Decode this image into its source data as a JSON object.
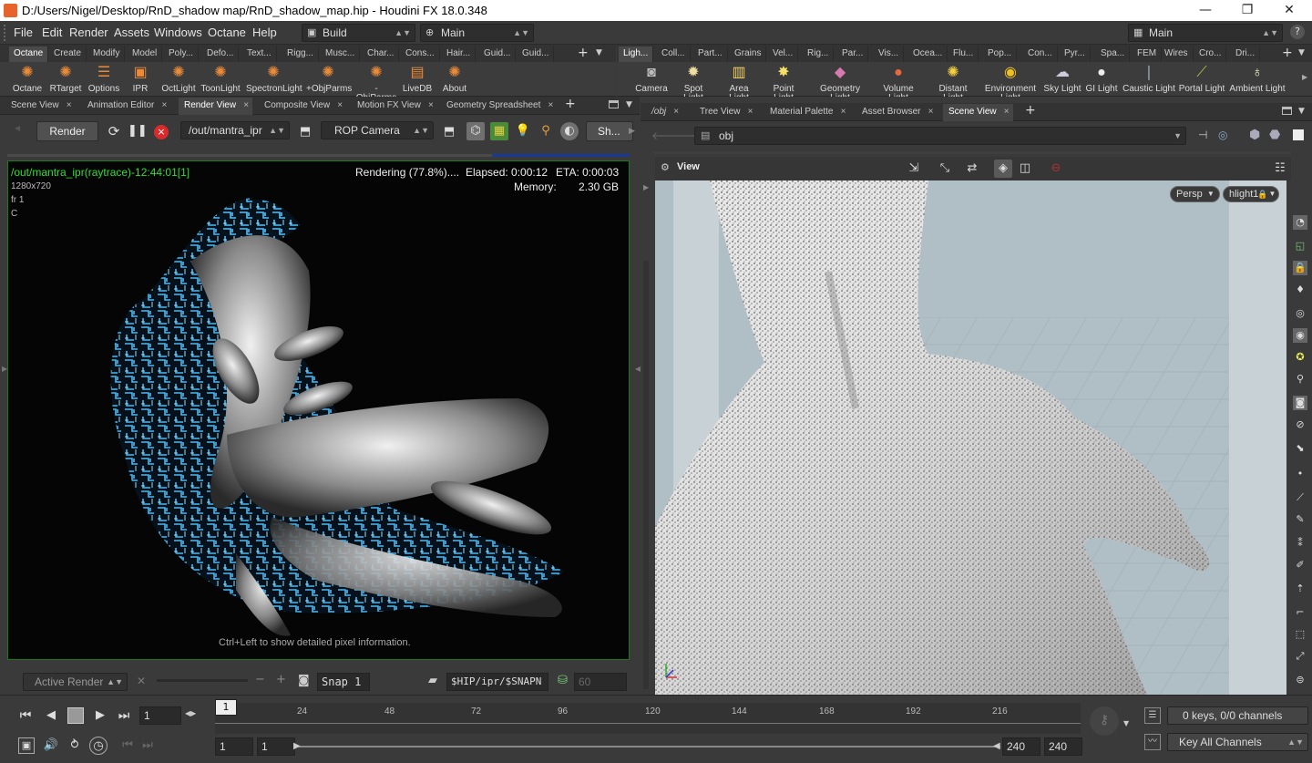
{
  "window": {
    "title": "D:/Users/Nigel/Desktop/RnD_shadow map/RnD_shadow_map.hip - Houdini FX 18.0.348",
    "controls": [
      "—",
      "❐",
      "✕"
    ]
  },
  "menubar": {
    "items": [
      "File",
      "Edit",
      "Render",
      "Assets",
      "Windows",
      "Octane",
      "Help"
    ],
    "desktop": "Build",
    "context": "Main",
    "right_desktop": "Main"
  },
  "shelf_left": {
    "tabs": [
      "Octane",
      "Create",
      "Modify",
      "Model",
      "Poly...",
      "Defo...",
      "Text...",
      "Rigg...",
      "Musc...",
      "Char...",
      "Cons...",
      "Hair...",
      "Guid...",
      "Guid..."
    ],
    "tools": [
      "Octane",
      "RTarget",
      "Options",
      "IPR",
      "OctLight",
      "ToonLight",
      "SpectronLight",
      "+ObjParms",
      "-ObjParms",
      "LiveDB",
      "About"
    ]
  },
  "shelf_right": {
    "tabs": [
      "Ligh...",
      "Coll...",
      "Part...",
      "Grains",
      "Vel...",
      "Rig...",
      "Par...",
      "Vis...",
      "Ocea...",
      "Flu...",
      "Pop...",
      "Con...",
      "Pyr...",
      "Spa...",
      "FEM",
      "Wires",
      "Cro...",
      "Dri..."
    ],
    "tools": [
      "Camera",
      "Spot Light",
      "Area Light",
      "Point Light",
      "Geometry Light",
      "Volume Light",
      "Distant Light",
      "Environment Light",
      "Sky Light",
      "GI Light",
      "Caustic Light",
      "Portal Light",
      "Ambient Light"
    ]
  },
  "left_pane": {
    "tabs": [
      "Scene View",
      "Animation Editor",
      "Render View",
      "Composite View",
      "Motion FX View",
      "Geometry Spreadsheet"
    ],
    "render_button": "Render",
    "rop_path": "/out/mantra_ipr",
    "camera": "ROP Camera",
    "sh_label": "Sh...",
    "overlay": {
      "path": "/out/mantra_ipr(raytrace)-12:44:01[1]",
      "resolution": "1280x720",
      "frame": "fr 1",
      "channel": "C",
      "status": "Rendering (77.8%)....",
      "elapsed": "Elapsed: 0:00:12",
      "eta": "ETA: 0:00:03",
      "memory_label": "Memory:",
      "memory_value": "2.30 GB",
      "hint": "Ctrl+Left to show detailed pixel information."
    },
    "bottom": {
      "active_render": "Active Render",
      "snap": "Snap 1",
      "snap_path": "$HIP/ipr/$SNAPN",
      "snap_num": "60"
    }
  },
  "right_pane": {
    "tabs": [
      "/obj",
      "Tree View",
      "Material Palette",
      "Asset Browser",
      "Scene View"
    ],
    "path": "obj",
    "view_label": "View",
    "persp": "Persp",
    "camera": "hlight1"
  },
  "timeline": {
    "ticks": [
      "24",
      "48",
      "72",
      "96",
      "120",
      "144",
      "168",
      "192",
      "216"
    ],
    "current_frame": "1",
    "frame_marker": "1",
    "start": "1",
    "start2": "1",
    "end": "240",
    "end2": "240",
    "keys": "0 keys, 0/0 channels",
    "key_all": "Key All Channels"
  },
  "colors": {
    "accent_green": "#1a9a1a",
    "overlay_green": "#33dd33",
    "glow_blue": "#4fc3ff"
  }
}
